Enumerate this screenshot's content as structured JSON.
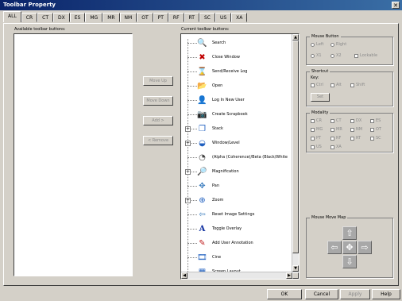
{
  "window": {
    "title": "Toolbar Property",
    "close_glyph": "✕"
  },
  "tabs": [
    "ALL",
    "CR",
    "CT",
    "DX",
    "ES",
    "MG",
    "MR",
    "NM",
    "OT",
    "PT",
    "RF",
    "RT",
    "SC",
    "US",
    "XA"
  ],
  "available": {
    "label": "Available toolbar buttons:"
  },
  "middle_buttons": {
    "move_up": "Move Up",
    "move_down": "Move Down",
    "add": "Add >",
    "remove": "< Remove"
  },
  "current": {
    "label": "Current toolbar buttons:",
    "items": [
      {
        "label": "Search",
        "icon": "search-icon",
        "glyph": "🔍"
      },
      {
        "label": "Close Window",
        "icon": "close-window-icon",
        "glyph": "✖"
      },
      {
        "label": "Send/Receive Log",
        "icon": "hourglass-icon",
        "glyph": "⌛"
      },
      {
        "label": "Open",
        "icon": "folder-icon",
        "glyph": "📂"
      },
      {
        "label": "Log In New User",
        "icon": "login-icon",
        "glyph": "👤"
      },
      {
        "label": "Create Scrapbook",
        "icon": "scrapbook-icon",
        "glyph": "📷"
      },
      {
        "label": "Stack",
        "icon": "stack-icon",
        "glyph": "❐"
      },
      {
        "label": "Window/Level",
        "icon": "window-level-icon",
        "glyph": "◒"
      },
      {
        "label": "(Alpha (Coherence)/Beta (Black/White",
        "icon": "alpha-beta-icon",
        "glyph": "◔"
      },
      {
        "label": "Magnification",
        "icon": "magnifier-icon",
        "glyph": "🔎"
      },
      {
        "label": "Pan",
        "icon": "pan-icon",
        "glyph": "✥"
      },
      {
        "label": "Zoom",
        "icon": "zoom-icon",
        "glyph": "⊕"
      },
      {
        "label": "Reset Image Settings",
        "icon": "reset-arrow-icon",
        "glyph": "⇦"
      },
      {
        "label": "Toggle Overlay",
        "icon": "overlay-a-icon",
        "glyph": "A"
      },
      {
        "label": "Add User Annotation",
        "icon": "annotation-icon",
        "glyph": "✎"
      },
      {
        "label": "Cine",
        "icon": "cine-icon",
        "glyph": "🎞"
      },
      {
        "label": "Screen Layout",
        "icon": "layout-icon",
        "glyph": "▦"
      }
    ]
  },
  "mouse_button": {
    "title": "Mouse Button",
    "left": "Left",
    "right": "Right",
    "x1": "X1",
    "x2": "X2",
    "lockable": "Lockable"
  },
  "shortcut": {
    "title": "Shortcut",
    "key": "Key:",
    "ctrl": "Ctrl",
    "alt": "Alt",
    "shift": "Shift",
    "set": "Set"
  },
  "modality": {
    "title": "Modality",
    "items": [
      "CR",
      "CT",
      "DX",
      "ES",
      "MG",
      "MR",
      "NM",
      "OT",
      "PT",
      "RF",
      "RT",
      "SC",
      "US",
      "XA"
    ]
  },
  "mouse_move_map": {
    "title": "Mouse Move Map",
    "up": "⇧",
    "down": "⇩",
    "left": "⇦",
    "right": "⇨",
    "center": "✥"
  },
  "footer": {
    "ok": "OK",
    "cancel": "Cancel",
    "apply": "Apply",
    "help": "Help"
  }
}
